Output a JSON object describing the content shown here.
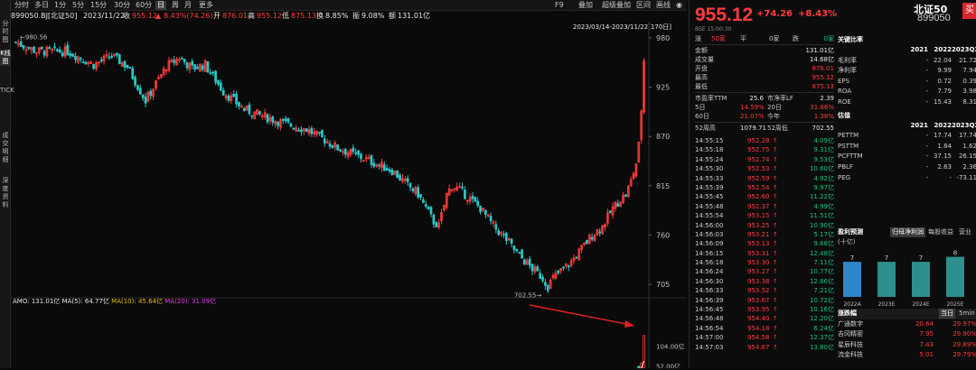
{
  "left_tabs": [
    {
      "label": "分时图",
      "active": false
    },
    {
      "label": "K线图",
      "active": true
    },
    {
      "label": "TICK",
      "active": false
    },
    {
      "label": "成交明细",
      "active": false
    },
    {
      "label": "深度资料",
      "active": false
    }
  ],
  "toolbar": {
    "timeframes": [
      "分时",
      "多日",
      "1分",
      "5分",
      "15分",
      "30分",
      "60分",
      "日",
      "周",
      "月",
      "更多"
    ],
    "active_timeframe": "日",
    "f9": "F9",
    "f9_label": "F9",
    "right_items": [
      "叠加",
      "超级叠加",
      "区间",
      "画线"
    ],
    "right_icons": [
      "pin-icon",
      "close-icon"
    ]
  },
  "info": {
    "code": "899050.BJ[北证50]",
    "date": "2023/11/22",
    "close_label": "收",
    "close": "955.12",
    "change_icon": "up-triangle-icon",
    "change": "8.43%(74.26)",
    "open_label": "开",
    "open": "876.01",
    "high_label": "高",
    "high": "955.12",
    "low_label": "低",
    "low": "875.13",
    "turnover_label": "换",
    "turnover": "8.85%",
    "amplitude_label": "振",
    "amplitude": "9.08%",
    "amount_label": "额",
    "amount": "131.01亿",
    "range": "2023/03/14-2023/11/22[170日]"
  },
  "chart_data": {
    "type": "candlestick",
    "price_axis_ticks": [
      "980",
      "925",
      "870",
      "815",
      "760",
      "705"
    ],
    "price_axis_values": [
      980,
      925,
      870,
      815,
      760,
      705
    ],
    "ylim": [
      696,
      990
    ],
    "period_high_label": "980.56",
    "period_low_label": "702.55",
    "candles_count": 170,
    "trend_close_keypoints": [
      [
        0,
        975
      ],
      [
        8,
        965
      ],
      [
        20,
        965
      ],
      [
        30,
        950
      ],
      [
        37,
        960
      ],
      [
        43,
        948
      ],
      [
        50,
        910
      ],
      [
        58,
        948
      ],
      [
        63,
        958
      ],
      [
        68,
        946
      ],
      [
        73,
        950
      ],
      [
        80,
        920
      ],
      [
        88,
        900
      ],
      [
        96,
        892
      ],
      [
        104,
        884
      ],
      [
        112,
        878
      ],
      [
        118,
        868
      ],
      [
        124,
        857
      ],
      [
        132,
        848
      ],
      [
        140,
        838
      ],
      [
        145,
        832
      ],
      [
        150,
        818
      ],
      [
        155,
        806
      ],
      [
        158,
        790
      ],
      [
        161,
        775
      ],
      [
        163,
        770
      ],
      [
        166,
        805
      ],
      [
        168,
        815
      ],
      [
        170,
        812
      ],
      [
        172,
        808
      ],
      [
        175,
        800
      ],
      [
        179,
        790
      ],
      [
        184,
        770
      ],
      [
        189,
        755
      ],
      [
        193,
        740
      ],
      [
        197,
        728
      ],
      [
        200,
        720
      ],
      [
        203,
        712
      ],
      [
        205,
        703
      ],
      [
        207,
        712
      ],
      [
        210,
        720
      ],
      [
        214,
        730
      ],
      [
        218,
        745
      ],
      [
        222,
        760
      ],
      [
        226,
        770
      ],
      [
        230,
        790
      ],
      [
        233,
        800
      ],
      [
        235,
        805
      ],
      [
        237,
        820
      ],
      [
        239,
        840
      ],
      [
        240,
        860
      ],
      [
        241,
        900
      ],
      [
        242,
        955
      ]
    ],
    "volume_axis_ticks": [
      "104.00亿",
      "52.00亿"
    ],
    "volume_axis_values": [
      104,
      52
    ],
    "volume_unit": "亿",
    "amo_label": "AMO:",
    "amo": "131.01亿",
    "ma5_label": "MA(5):",
    "ma5": "64.77亿",
    "ma10_label": "MA(10):",
    "ma10": "45.64亿",
    "ma20_label": "MA(20):",
    "ma20": "31.09亿",
    "last_volume": 131.01
  },
  "quote": {
    "name": "北证50",
    "code": "899050",
    "price": "955.12",
    "change": "+74.26",
    "change_pct": "+8.43%",
    "buy_label": "买",
    "exchange_time": "BSE 15:00:30",
    "rise_label": "涨",
    "rise_val": "50家",
    "flat_label": "平",
    "flat_val": "0家",
    "fall_label": "跌",
    "fall_val": "0家",
    "rows": [
      {
        "label": "金额",
        "value": "131.01亿",
        "color": "white"
      },
      {
        "label": "成交量",
        "value": "14.68亿",
        "color": "white"
      },
      {
        "label": "开盘",
        "value": "876.01",
        "color": "red"
      },
      {
        "label": "最高",
        "value": "955.12",
        "color": "red"
      },
      {
        "label": "最低",
        "value": "875.13",
        "color": "red"
      }
    ],
    "pe_label": "市盈率TTM",
    "pe": "25.6",
    "pb_label": "市净率LF",
    "pb": "2.39",
    "d5_label": "5日",
    "d5": "14.59%",
    "d20_label": "20日",
    "d20": "31.86%",
    "d60_label": "60日",
    "d60": "21.07%",
    "ytd_label": "今年",
    "ytd": "1.38%",
    "w52h_label": "52周高",
    "w52h": "1079.71",
    "w52l_label": "52周低",
    "w52l": "702.55"
  },
  "ticks": [
    {
      "time": "14:55:15",
      "price": "952.28",
      "vol": "4.09亿"
    },
    {
      "time": "14:55:18",
      "price": "952.75",
      "vol": "9.31亿"
    },
    {
      "time": "14:55:24",
      "price": "952.74",
      "vol": "9.53亿"
    },
    {
      "time": "14:55:30",
      "price": "952.53",
      "vol": "10.60亿"
    },
    {
      "time": "14:55:33",
      "price": "952.59",
      "vol": "4.92亿"
    },
    {
      "time": "14:55:39",
      "price": "952.54",
      "vol": "9.97亿"
    },
    {
      "time": "14:55:45",
      "price": "952.60",
      "vol": "11.22亿"
    },
    {
      "time": "14:55:48",
      "price": "952.37",
      "vol": "4.99亿"
    },
    {
      "time": "14:55:54",
      "price": "953.15",
      "vol": "11.51亿"
    },
    {
      "time": "14:56:00",
      "price": "953.25",
      "vol": "10.90亿"
    },
    {
      "time": "14:56:03",
      "price": "953.21",
      "vol": "5.17亿"
    },
    {
      "time": "14:56:09",
      "price": "953.13",
      "vol": "9.68亿"
    },
    {
      "time": "14:56:15",
      "price": "953.31",
      "vol": "12.48亿"
    },
    {
      "time": "14:56:18",
      "price": "953.30",
      "vol": "7.11亿"
    },
    {
      "time": "14:56:24",
      "price": "953.27",
      "vol": "10.77亿"
    },
    {
      "time": "14:56:30",
      "price": "953.38",
      "vol": "12.86亿"
    },
    {
      "time": "14:56:33",
      "price": "953.52",
      "vol": "7.21亿"
    },
    {
      "time": "14:56:39",
      "price": "953.67",
      "vol": "10.72亿"
    },
    {
      "time": "14:56:45",
      "price": "953.95",
      "vol": "10.16亿"
    },
    {
      "time": "14:56:48",
      "price": "954.40",
      "vol": "12.20亿"
    },
    {
      "time": "14:56:54",
      "price": "954.18",
      "vol": "6.24亿"
    },
    {
      "time": "14:57:00",
      "price": "954.58",
      "vol": "12.37亿"
    },
    {
      "time": "14:57:03",
      "price": "954.67",
      "vol": "13.80亿"
    }
  ],
  "ratios": {
    "title": "关键比率",
    "years": [
      "2021",
      "2022",
      "2023Q3"
    ],
    "rows": [
      {
        "name": "毛利率",
        "v": [
          "-",
          "22.04",
          "21.72"
        ]
      },
      {
        "name": "净利率",
        "v": [
          "-",
          "9.99",
          "7.94"
        ]
      },
      {
        "name": "EPS",
        "v": [
          "-",
          "0.72",
          "0.39"
        ]
      },
      {
        "name": "ROA",
        "v": [
          "-",
          "7.79",
          "3.98"
        ]
      },
      {
        "name": "ROE",
        "v": [
          "-",
          "15.43",
          "8.31"
        ]
      }
    ]
  },
  "valuation": {
    "title": "估值",
    "years": [
      "2021",
      "2022",
      "2023Q3"
    ],
    "rows": [
      {
        "name": "PETTM",
        "v": [
          "-",
          "17.74",
          "17.74"
        ]
      },
      {
        "name": "PSTTM",
        "v": [
          "-",
          "1.84",
          "1.62"
        ]
      },
      {
        "name": "PCFTTM",
        "v": [
          "-",
          "37.15",
          "26.15"
        ]
      },
      {
        "name": "PBLF",
        "v": [
          "-",
          "2.63",
          "2.36"
        ]
      },
      {
        "name": "PEG",
        "v": [
          "-",
          "-",
          "-73.11"
        ]
      }
    ]
  },
  "profit_forecast": {
    "title": "盈利预测",
    "unit": "(十亿)",
    "tabs": [
      "归母净利润",
      "每股收益",
      "营业"
    ],
    "bars": [
      {
        "label": "2022A",
        "value": 7,
        "color": "#2f86c8"
      },
      {
        "label": "2023E",
        "value": 7,
        "color": "#2e8f8f"
      },
      {
        "label": "2024E",
        "value": 7,
        "color": "#2e8f8f"
      },
      {
        "label": "2025E",
        "value": 8,
        "color": "#2e8f8f"
      }
    ]
  },
  "boards": {
    "title": "涨跌幅",
    "tabs": [
      "当日",
      "5min"
    ],
    "rows": [
      {
        "name": "广通数字",
        "a": "20.64",
        "b": "29.97%"
      },
      {
        "name": "吉冈精密",
        "a": "7.95",
        "b": "29.90%"
      },
      {
        "name": "星辰科技",
        "a": "7.43",
        "b": "29.89%"
      },
      {
        "name": "流金科技",
        "a": "5.01",
        "b": "29.79%"
      }
    ]
  }
}
